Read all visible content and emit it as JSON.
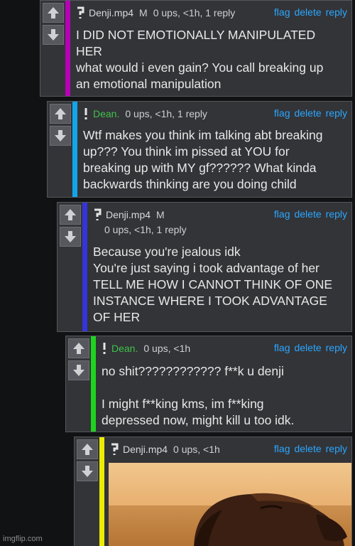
{
  "labels": {
    "flag": "flag",
    "delete": "delete",
    "reply": "reply"
  },
  "comments": [
    {
      "user": "Denji.mp4",
      "mod": "M",
      "meta": "0 ups, <1h, 1 reply",
      "lines": [
        "I DID NOT EMOTIONALLY MANIPULATED",
        "HER",
        "what would i even gain? You call breaking up",
        "an emotional manipulation"
      ],
      "bar_color": "#b600b6"
    },
    {
      "user": "Dean.",
      "meta": "0 ups, <1h, 1 reply",
      "lines": [
        "Wtf makes you think im talking abt breaking",
        "up??? You think im pissed at YOU for",
        "breaking up with MY gf?????? What kinda",
        "backwards thinking are you doing child"
      ],
      "bar_color": "#12a5e8"
    },
    {
      "user": "Denji.mp4",
      "mod": "M",
      "meta": "0 ups, <1h, 1 reply",
      "lines": [
        "Because you're jealous idk",
        "You're just saying i took advantage of her",
        "TELL ME HOW I CANNOT THINK OF ONE",
        "INSTANCE WHERE I TOOK ADVANTAGE",
        "OF HER"
      ],
      "bar_color": "#3434d9"
    },
    {
      "user": "Dean.",
      "meta": "0 ups, <1h",
      "lines": [
        "no shit???????????? f**k u denji",
        "",
        "I might f**king kms, im f**king",
        "depressed now, might kill u too idk."
      ],
      "bar_color": "#1fd41f"
    },
    {
      "user": "Denji.mp4",
      "meta": "0 ups, <1h",
      "lines": [],
      "bar_color": "#ecec00"
    }
  ],
  "watermark": "imgflip.com"
}
